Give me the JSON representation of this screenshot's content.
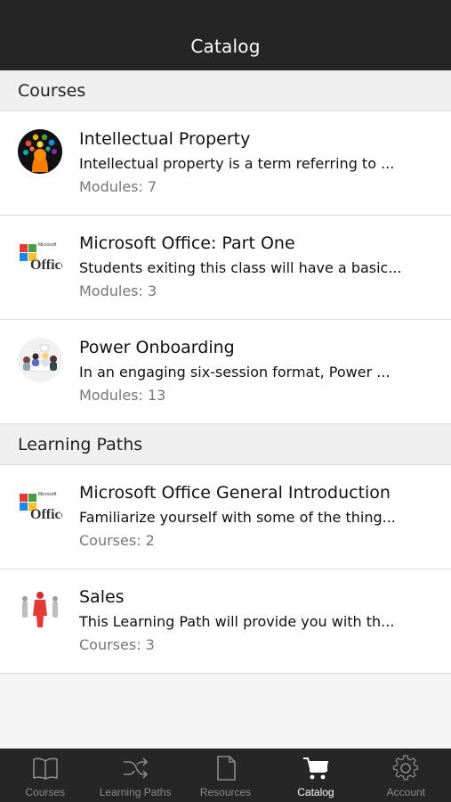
{
  "header": {
    "title": "Catalog"
  },
  "courses": {
    "section_label": "Courses",
    "items": [
      {
        "title": "Intellectual Property",
        "description": "Intellectual property is a term referring to ...",
        "meta": "Modules: 7",
        "thumb": "intellectual-property-thumbnail"
      },
      {
        "title": "Microsoft Office: Part One",
        "description": "Students exiting this class will have a basic...",
        "meta": "Modules: 3",
        "thumb": "microsoft-office-thumbnail"
      },
      {
        "title": "Power Onboarding",
        "description": "In an engaging six-session format, Power ...",
        "meta": "Modules: 13",
        "thumb": "onboarding-meeting-thumbnail"
      }
    ]
  },
  "paths": {
    "section_label": "Learning Paths",
    "items": [
      {
        "title": "Microsoft Office General Introduction",
        "description": "Familiarize yourself with some of the thing...",
        "meta": "Courses: 2",
        "thumb": "microsoft-office-thumbnail"
      },
      {
        "title": "Sales",
        "description": "This Learning Path will provide you with th...",
        "meta": "Courses: 3",
        "thumb": "sales-figure-thumbnail"
      }
    ]
  },
  "tabs": [
    {
      "label": "Courses",
      "icon": "book-icon",
      "active": false
    },
    {
      "label": "Learning Paths",
      "icon": "shuffle-icon",
      "active": false
    },
    {
      "label": "Resources",
      "icon": "document-icon",
      "active": false
    },
    {
      "label": "Catalog",
      "icon": "cart-icon",
      "active": true
    },
    {
      "label": "Account",
      "icon": "gear-icon",
      "active": false
    }
  ],
  "colors": {
    "topbar": "#252525",
    "tabbar": "#262626",
    "active_tab": "#ffffff",
    "inactive_tab": "#8a8a8a"
  }
}
